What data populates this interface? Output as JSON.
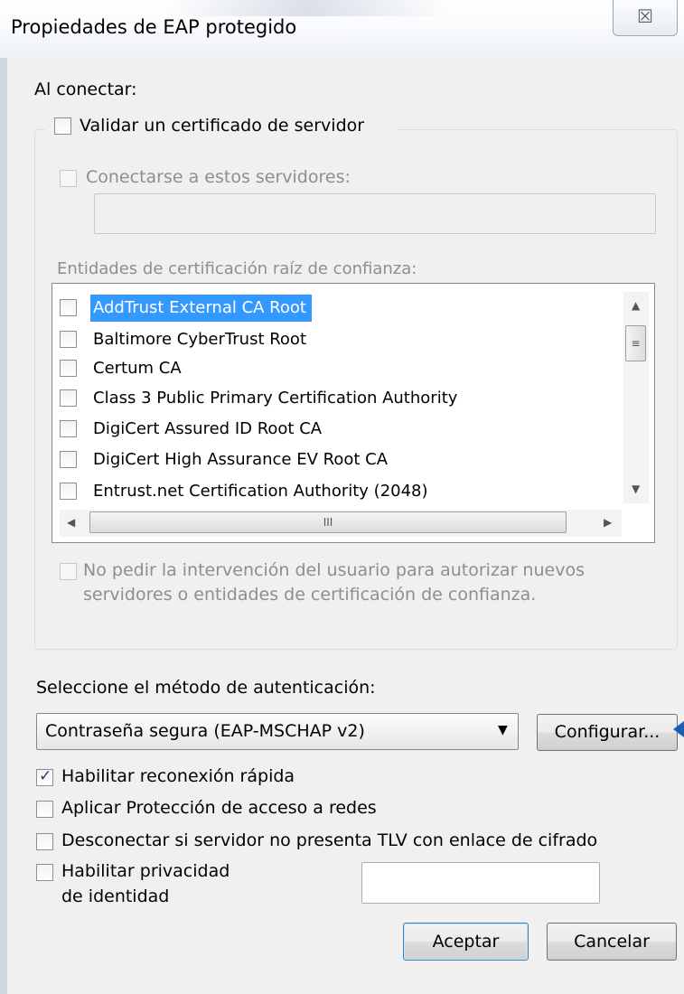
{
  "window": {
    "title": "Propiedades de EAP protegido",
    "close_symbol": "☒"
  },
  "connect": {
    "heading": "Al conectar:",
    "validate_cert": {
      "label": "Validar un certificado de servidor",
      "checked": false
    },
    "connect_servers": {
      "label": "Conectarse a estos servidores:",
      "checked": false,
      "value": ""
    },
    "trusted_roots_label": "Entidades de certificación raíz de confianza:",
    "trusted_roots": [
      {
        "label": "AddTrust External CA Root",
        "checked": false,
        "selected": true
      },
      {
        "label": "Baltimore CyberTrust Root",
        "checked": false,
        "selected": false
      },
      {
        "label": "Certum CA",
        "checked": false,
        "selected": false
      },
      {
        "label": "Class 3 Public Primary Certification Authority",
        "checked": false,
        "selected": false
      },
      {
        "label": "DigiCert Assured ID Root CA",
        "checked": false,
        "selected": false
      },
      {
        "label": "DigiCert High Assurance EV Root CA",
        "checked": false,
        "selected": false
      },
      {
        "label": "Entrust.net Certification Authority (2048)",
        "checked": false,
        "selected": false
      }
    ],
    "no_prompt": {
      "line1": "No pedir la intervención del usuario para autorizar nuevos",
      "line2": "servidores o entidades de certificación de confianza.",
      "checked": false
    }
  },
  "auth": {
    "heading": "Seleccione el método de autenticación:",
    "method_selected": "Contraseña segura (EAP-MSCHAP v2)",
    "configure_label": "Configurar..."
  },
  "options": {
    "fast_reconnect": {
      "label": "Habilitar reconexión rápida",
      "checked": true
    },
    "nap": {
      "label": "Aplicar Protección de acceso a redes",
      "checked": false
    },
    "disconnect_tlv": {
      "label": "Desconectar si servidor no presenta TLV con enlace de cifrado",
      "checked": false
    },
    "identity_privacy": {
      "line1": "Habilitar privacidad",
      "line2": "de identidad",
      "checked": false,
      "value": ""
    }
  },
  "footer": {
    "ok_label": "Aceptar",
    "cancel_label": "Cancelar"
  },
  "colors": {
    "selection": "#3399ff",
    "dialog_bg": "#f0f0f0",
    "callout_arrow": "#1a5fb4"
  }
}
